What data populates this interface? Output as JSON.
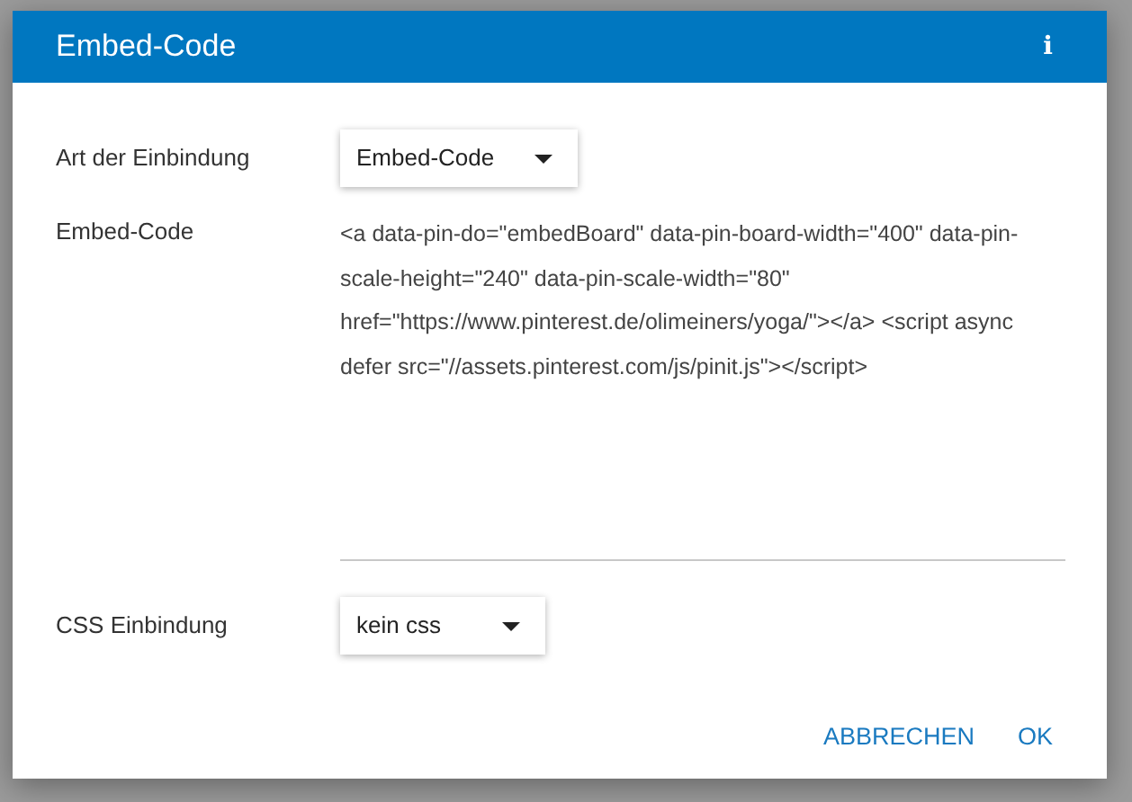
{
  "dialog": {
    "title": "Embed-Code",
    "info_icon": "i"
  },
  "fields": [
    {
      "kind": "select",
      "label": "Art der Einbindung",
      "value": "Embed-Code"
    },
    {
      "kind": "textarea",
      "label": "Embed-Code",
      "value": "<a data-pin-do=\"embedBoard\" data-pin-board-width=\"400\" data-pin-scale-height=\"240\" data-pin-scale-width=\"80\" href=\"https://www.pinterest.de/olimeiners/yoga/\"></a> <script async defer src=\"//assets.pinterest.com/js/pinit.js\"></script>"
    },
    {
      "kind": "select",
      "label": "CSS Einbindung",
      "value": "kein css"
    }
  ],
  "buttons": [
    "ABBRECHEN",
    "OK"
  ]
}
